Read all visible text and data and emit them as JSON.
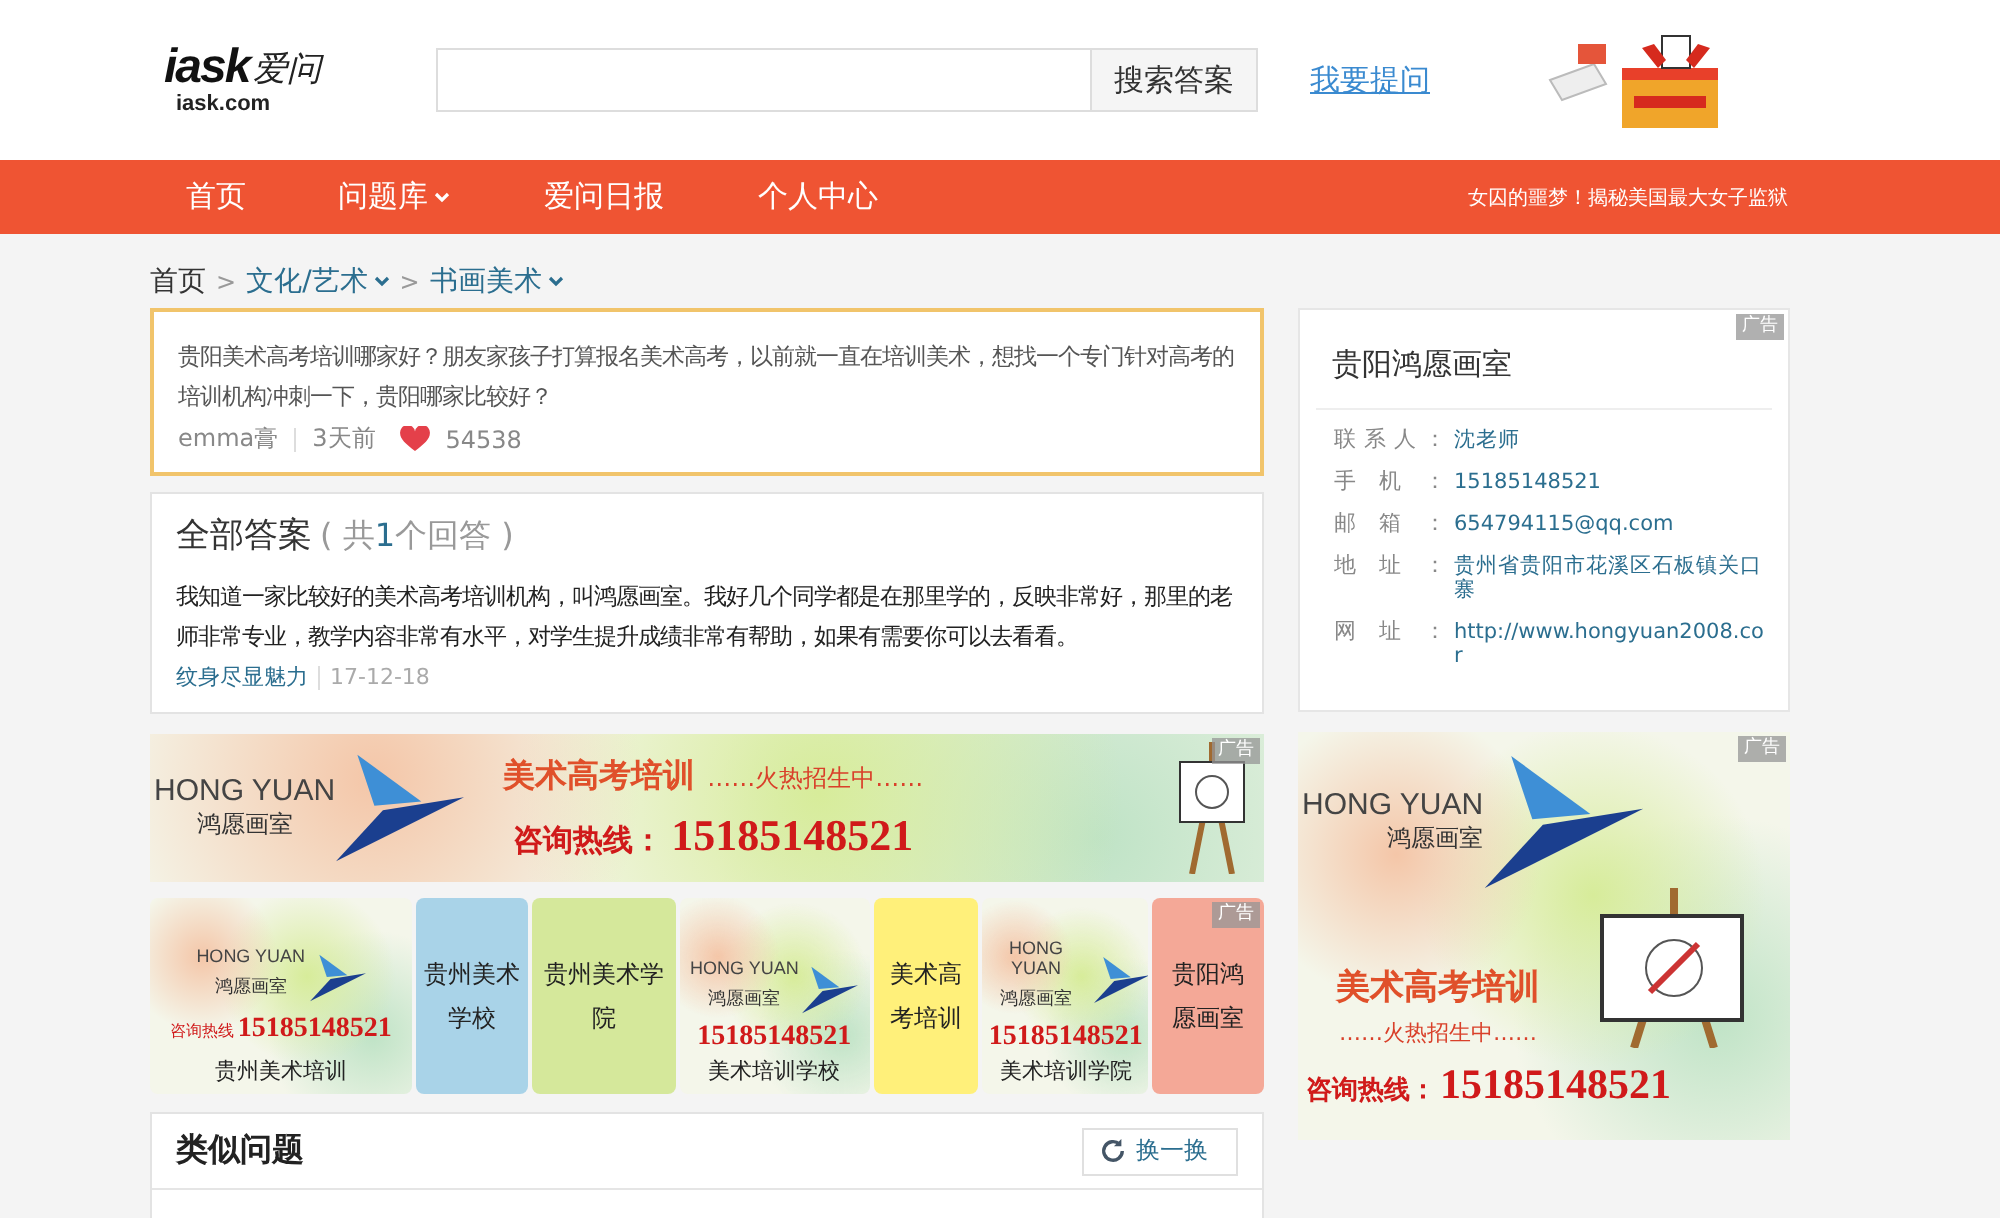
{
  "header": {
    "logo_mark": "iask",
    "logo_cn": "爱问",
    "logo_domain": "iask.com",
    "search_button": "搜索答案",
    "ask_link": "我要提问"
  },
  "nav": {
    "items": [
      {
        "label": "首页",
        "dropdown": false
      },
      {
        "label": "问题库",
        "dropdown": true
      },
      {
        "label": "爱问日报",
        "dropdown": false
      },
      {
        "label": "个人中心",
        "dropdown": false
      }
    ],
    "promo": "女囚的噩梦！揭秘美国最大女子监狱"
  },
  "breadcrumb": {
    "items": [
      {
        "label": "首页",
        "dropdown": false
      },
      {
        "label": "文化/艺术",
        "dropdown": true
      },
      {
        "label": "书画美术",
        "dropdown": true
      }
    ],
    "separators": [
      ">",
      ">"
    ]
  },
  "question": {
    "text": "贵阳美术高考培训哪家好？朋友家孩子打算报名美术高考，以前就一直在培训美术，想找一个专门针对高考的培训机构冲刺一下，贵阳哪家比较好？",
    "user": "emma膏",
    "time": "3天前",
    "likes": "54538"
  },
  "answers": {
    "title": "全部答案",
    "count_open": "( 共",
    "count": "1",
    "count_close": "个回答 )",
    "items": [
      {
        "text": "我知道一家比较好的美术高考培训机构，叫鸿愿画室。我好几个同学都是在那里学的，反映非常好，那里的老师非常专业，教学内容非常有水平，对学生提升成绩非常有帮助，如果有需要你可以去看看。",
        "user": "纹身尽显魅力",
        "date": "17-12-18"
      }
    ]
  },
  "banner": {
    "brand": "HONG YUAN",
    "name": "鸿愿画室",
    "headline": "美术高考培训",
    "tagline": "……火热招生中……",
    "hotline": "咨询热线：",
    "phone": "15185148521",
    "ad_label": "广告"
  },
  "tiles": {
    "ad_label": "广告",
    "items": [
      {
        "kind": "image",
        "brand": "HONG YUAN",
        "name": "鸿愿画室",
        "hotline": "咨询热线",
        "phone": "15185148521",
        "caption": "贵州美术培训"
      },
      {
        "kind": "color",
        "color": "#a9d3e8",
        "label": "贵州美术学校"
      },
      {
        "kind": "color",
        "color": "#d5e89b",
        "label": "贵州美术学院"
      },
      {
        "kind": "image",
        "brand": "HONG YUAN",
        "name": "鸿愿画室",
        "phone": "15185148521",
        "caption": "美术培训学校"
      },
      {
        "kind": "color",
        "color": "#fff07a",
        "label": "美术高考培训"
      },
      {
        "kind": "image",
        "brand": "HONG YUAN",
        "name": "鸿愿画室",
        "phone": "15185148521",
        "caption": "美术培训学院"
      },
      {
        "kind": "color",
        "color": "#f4a897",
        "label": "贵阳鸿愿画室"
      }
    ]
  },
  "similar": {
    "title": "类似问题",
    "refresh": "换一换"
  },
  "contact": {
    "ad_label": "广告",
    "title": "贵阳鸿愿画室",
    "fields": [
      {
        "label": "联 系 人 ：",
        "value": "沈老师"
      },
      {
        "label": "手 机 ：",
        "value": "15185148521"
      },
      {
        "label": "邮 箱 ：",
        "value": "654794115@qq.com"
      },
      {
        "label": "地 址 ：",
        "value": "贵州省贵阳市花溪区石板镇关口寨"
      },
      {
        "label": "网 址 ：",
        "value": "http://www.hongyuan2008.cor"
      }
    ]
  },
  "side_ad": {
    "brand": "HONG YUAN",
    "name": "鸿愿画室",
    "headline": "美术高考培训",
    "tagline": "……火热招生中……",
    "hotline": "咨询热线：",
    "phone": "15185148521",
    "ad_label": "广告"
  }
}
